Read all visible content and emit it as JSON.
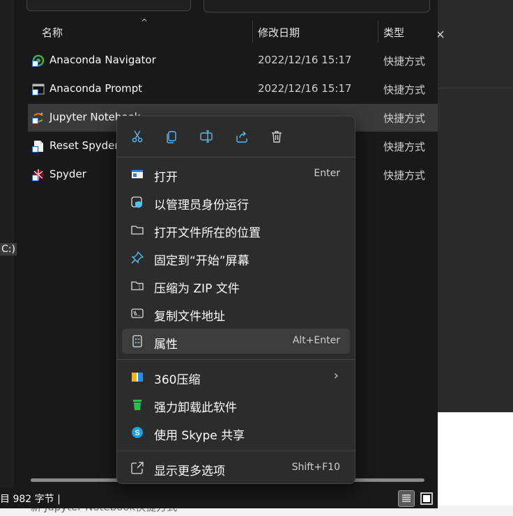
{
  "explorer": {
    "columns": {
      "name": "名称",
      "date": "修改日期",
      "type": "类型"
    },
    "files": [
      {
        "name": "Anaconda Navigator",
        "date": "2022/12/16 15:17",
        "type": "快捷方式",
        "icon": "anaconda-navigator-icon"
      },
      {
        "name": "Anaconda Prompt",
        "date": "2022/12/16 15:17",
        "type": "快捷方式",
        "icon": "anaconda-prompt-icon"
      },
      {
        "name": "Jupyter Notebook",
        "date": "",
        "type": "快捷方式",
        "icon": "jupyter-icon",
        "selected": true
      },
      {
        "name": "Reset Spyder",
        "date": "",
        "type": "快捷方式",
        "icon": "reset-spyder-icon"
      },
      {
        "name": "Spyder",
        "date": "",
        "type": "快捷方式",
        "icon": "spyder-icon"
      }
    ],
    "drive_label": "C:)",
    "status": "目  982 字节  |",
    "bottom_fragment": "新 Jupyter Notebook快捷方式"
  },
  "context_menu": {
    "toolbar": [
      {
        "name": "cut",
        "icon": "scissors-icon"
      },
      {
        "name": "copy",
        "icon": "copy-icon"
      },
      {
        "name": "rename",
        "icon": "rename-icon"
      },
      {
        "name": "share",
        "icon": "share-icon"
      },
      {
        "name": "delete",
        "icon": "trash-icon"
      }
    ],
    "items": {
      "open": {
        "label": "打开",
        "shortcut": "Enter"
      },
      "run_as_admin": {
        "label": "以管理员身份运行"
      },
      "open_location": {
        "label": "打开文件所在的位置"
      },
      "pin_start": {
        "label": "固定到“开始”屏幕"
      },
      "compress_zip": {
        "label": "压缩为 ZIP 文件"
      },
      "copy_path": {
        "label": "复制文件地址"
      },
      "properties": {
        "label": "属性",
        "shortcut": "Alt+Enter"
      },
      "compress_360": {
        "label": "360压缩"
      },
      "uninstall": {
        "label": "强力卸载此软件"
      },
      "skype_share": {
        "label": "使用 Skype 共享"
      },
      "more_options": {
        "label": "显示更多选项",
        "shortcut": "Shift+F10"
      }
    }
  },
  "colors": {
    "accent": "#4cc2ff",
    "menu_bg": "#2c2c2c",
    "window_bg": "#191919",
    "selection": "#3a3a3a"
  }
}
